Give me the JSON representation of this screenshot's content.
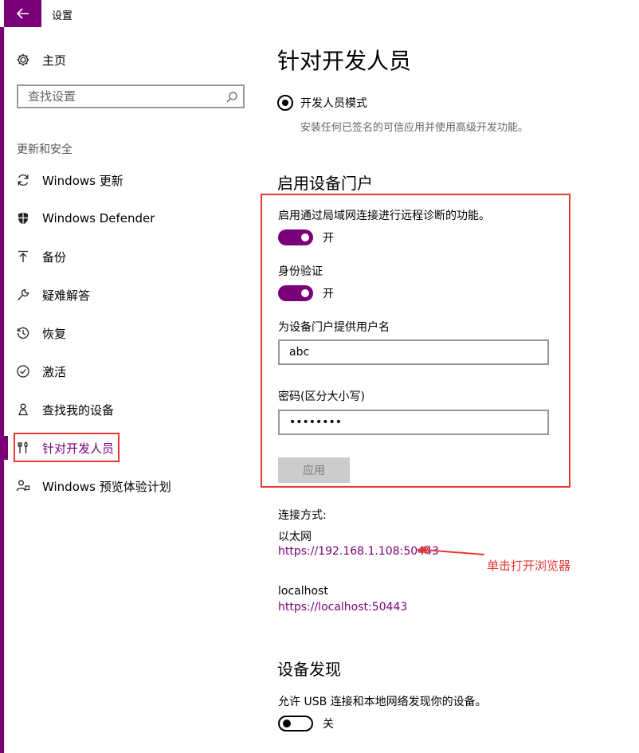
{
  "window": {
    "title": "设置",
    "back_icon": "back-arrow-icon",
    "accent": "#7a007a"
  },
  "sidebar": {
    "home_label": "主页",
    "search_placeholder": "查找设置",
    "section_label": "更新和安全",
    "items": [
      {
        "label": "Windows 更新",
        "icon": "sync-icon"
      },
      {
        "label": "Windows Defender",
        "icon": "shield-icon"
      },
      {
        "label": "备份",
        "icon": "upload-icon"
      },
      {
        "label": "疑难解答",
        "icon": "wrench-icon"
      },
      {
        "label": "恢复",
        "icon": "history-icon"
      },
      {
        "label": "激活",
        "icon": "checkmark-circle-icon"
      },
      {
        "label": "查找我的设备",
        "icon": "person-location-icon"
      },
      {
        "label": "针对开发人员",
        "icon": "developer-tools-icon",
        "selected": true
      },
      {
        "label": "Windows 预览体验计划",
        "icon": "insider-icon"
      }
    ]
  },
  "main": {
    "title": "针对开发人员",
    "dev_mode": {
      "label": "开发人员模式",
      "description": "安装任何已签名的可信应用并使用高级开发功能。",
      "checked": true
    },
    "portal": {
      "heading": "启用设备门户",
      "remote_label": "启用通过局域网连接进行远程诊断的功能。",
      "remote_state": "开",
      "auth_label": "身份验证",
      "auth_state": "开",
      "username_label": "为设备门户提供用户名",
      "username_value": "abc",
      "password_label": "密码(区分大小写)",
      "password_value": "abcdefgh",
      "apply_label": "应用"
    },
    "connection": {
      "label": "连接方式:",
      "ethernet_label": "以太网",
      "ethernet_url": "https://192.168.1.108:50443",
      "localhost_label": "localhost",
      "localhost_url": "https://localhost:50443"
    },
    "annotation": {
      "text": "单击打开浏览器",
      "color": "#e53935"
    },
    "discovery": {
      "heading": "设备发现",
      "description": "允许 USB 连接和本地网络发现你的设备。",
      "state": "关"
    }
  }
}
